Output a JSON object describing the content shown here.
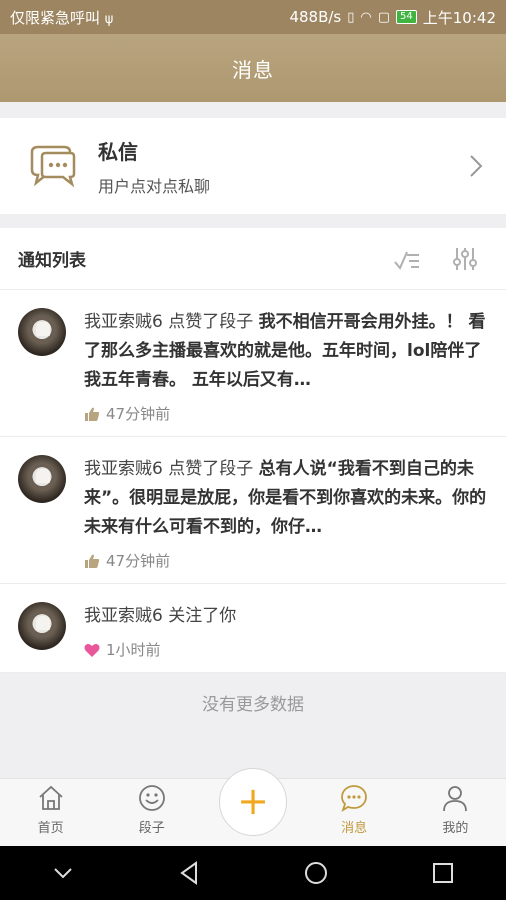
{
  "status_bar": {
    "carrier": "仅限紧急呼叫",
    "usb_icon": "usb-icon",
    "speed": "488B/s",
    "battery": "54",
    "time": "上午10:42"
  },
  "header": {
    "title": "消息"
  },
  "private_message": {
    "icon": "chat-bubble-icon",
    "title": "私信",
    "subtitle": "用户点对点私聊"
  },
  "notifications": {
    "title": "通知列表",
    "items": [
      {
        "user": "我亚索贼6",
        "action": "点赞了段子",
        "content": "我不相信开哥会用外挂。！ 看了那么多主播最喜欢的就是他。五年时间，lol陪伴了我五年青春。 五年以后又有…",
        "meta_icon": "thumbs-up-icon",
        "time": "47分钟前"
      },
      {
        "user": "我亚索贼6",
        "action": "点赞了段子",
        "content": "总有人说“我看不到自己的未来”。很明显是放屁，你是看不到你喜欢的未来。你的未来有什么可看不到的，你仔…",
        "meta_icon": "thumbs-up-icon",
        "time": "47分钟前"
      },
      {
        "user": "我亚索贼6",
        "action": "关注了你",
        "content": "",
        "meta_icon": "heart-icon",
        "time": "1小时前"
      }
    ],
    "no_more": "没有更多数据"
  },
  "tabs": [
    {
      "label": "首页",
      "icon": "home-icon"
    },
    {
      "label": "段子",
      "icon": "smiley-icon"
    },
    {
      "label": "消息",
      "icon": "message-icon"
    },
    {
      "label": "我的",
      "icon": "person-icon"
    }
  ],
  "fab": {
    "symbol": "+"
  },
  "colors": {
    "header": "#ad9870",
    "accent": "#c29a3e",
    "fab": "#f0a81e",
    "heart": "#e7579a"
  }
}
